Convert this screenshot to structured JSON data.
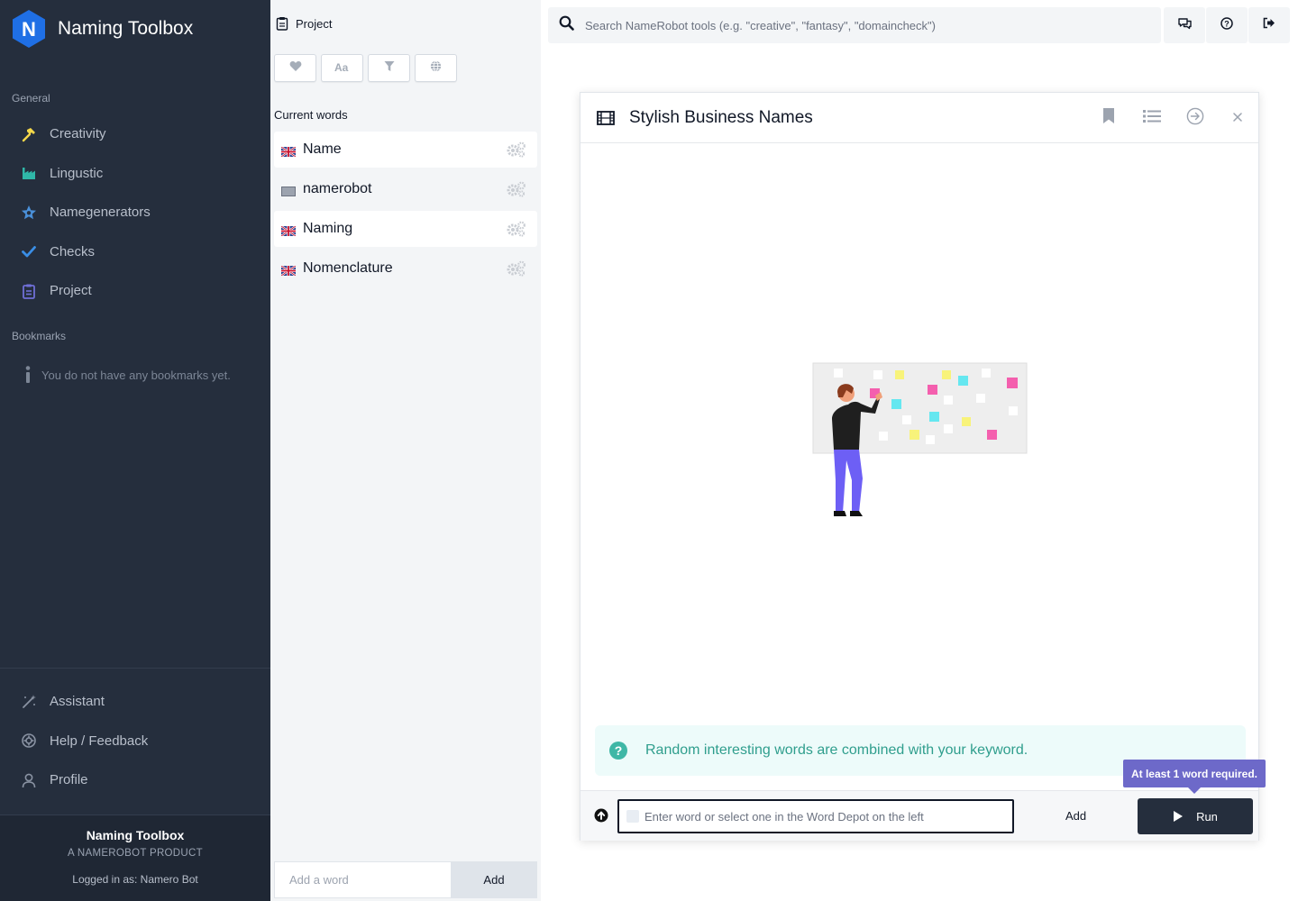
{
  "app": {
    "title": "Naming Toolbox",
    "logo_letter": "N"
  },
  "sidebar": {
    "section_general": "General",
    "items": [
      {
        "label": "Creativity",
        "icon": "hammer-icon",
        "color": "#f5d84a"
      },
      {
        "label": "Lingustic",
        "icon": "factory-icon",
        "color": "#2fb7a8"
      },
      {
        "label": "Namegenerators",
        "icon": "star-badge-icon",
        "color": "#4a90d9"
      },
      {
        "label": "Checks",
        "icon": "checkmark-icon",
        "color": "#3a8ee6"
      },
      {
        "label": "Project",
        "icon": "clipboard-icon",
        "color": "#6f6fd6"
      }
    ],
    "section_bookmarks": "Bookmarks",
    "bookmarks_empty": "You do not have any bookmarks yet.",
    "bottom_items": [
      {
        "label": "Assistant",
        "icon": "magic-wand-icon"
      },
      {
        "label": "Help / Feedback",
        "icon": "lifebuoy-icon"
      },
      {
        "label": "Profile",
        "icon": "user-icon"
      }
    ],
    "footer": {
      "title": "Naming Toolbox",
      "subtitle": "A NAMEROBOT PRODUCT",
      "logged_in": "Logged in as: Namero Bot"
    }
  },
  "project": {
    "header": "Project",
    "toolbar_icons": [
      "heart-icon",
      "font-case-icon",
      "filter-icon",
      "globe-icon"
    ],
    "current_words_label": "Current words",
    "words": [
      {
        "text": "Name",
        "flag": "uk"
      },
      {
        "text": "namerobot",
        "flag": "none"
      },
      {
        "text": "Naming",
        "flag": "uk"
      },
      {
        "text": "Nomenclature",
        "flag": "uk"
      }
    ],
    "add_placeholder": "Add a word",
    "add_button": "Add"
  },
  "topbar": {
    "search_placeholder": "Search NameRobot tools (e.g. \"creative\", \"fantasy\", \"domaincheck\")",
    "buttons": [
      "chat-icon",
      "help-icon",
      "logout-icon"
    ]
  },
  "panel": {
    "title": "Stylish Business Names",
    "actions": [
      "bookmark-icon",
      "list-icon",
      "arrow-circle-icon",
      "close-icon"
    ],
    "info_text": "Random interesting words are combined with your keyword.",
    "input_placeholder": "Enter word or select one in the Word Depot on the left",
    "add_label": "Add",
    "run_label": "Run",
    "tooltip": "At least 1 word required."
  },
  "colors": {
    "sidebar_bg": "#252e3d",
    "accent_teal": "#2f9e8d",
    "tooltip": "#6d69c9",
    "run_button": "#252e3d"
  }
}
